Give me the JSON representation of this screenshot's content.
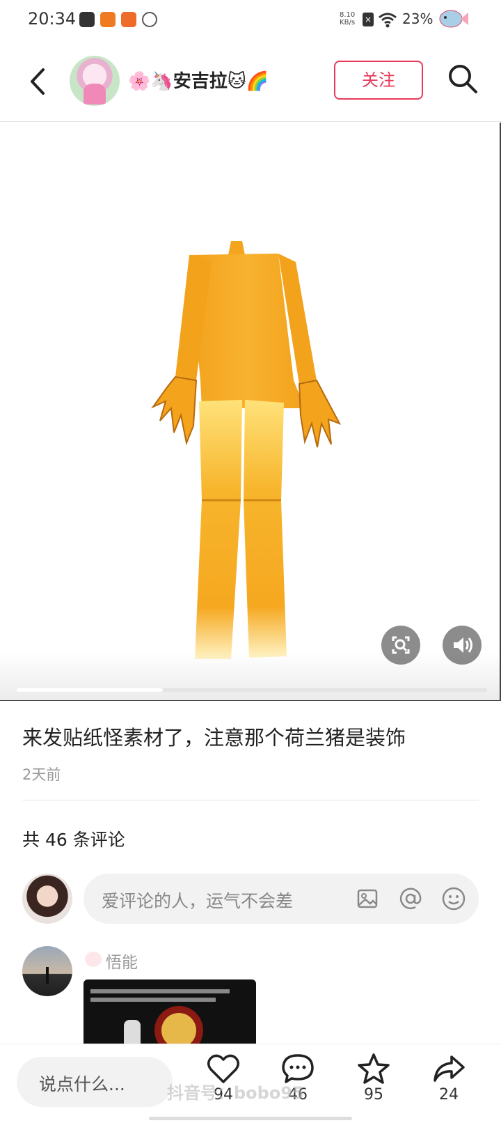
{
  "status_bar": {
    "time": "20:34",
    "net_speed_value": "8.10",
    "net_speed_unit": "KB/s",
    "battery": "23%",
    "icons": [
      "app-icon-dark",
      "app-icon-orange",
      "app-icon-orange-2",
      "app-icon-link",
      "sim-x-icon",
      "wifi-icon",
      "fish-icon"
    ]
  },
  "header": {
    "username": "🌸🦄安吉拉🐱🌈",
    "follow_label": "关注",
    "icons": [
      "back-icon",
      "search-icon"
    ]
  },
  "media": {
    "description_icons": [
      "scan-icon",
      "sound-icon"
    ],
    "progress_fraction": 0.31
  },
  "post": {
    "caption": "来发贴纸怪素材了，注意那个荷兰猪是装饰",
    "time_ago": "2天前",
    "comment_count_label": "共 46 条评论"
  },
  "comment_input": {
    "placeholder": "爱评论的人，运气不会差",
    "icons": [
      "image-icon",
      "at-icon",
      "emoji-icon"
    ]
  },
  "comments": [
    {
      "author": "悟能"
    }
  ],
  "bottom_bar": {
    "input_label": "说点什么...",
    "like_count": "94",
    "comment_count": "46",
    "favorite_count": "95",
    "share_count": "24",
    "watermark": "抖音号：bobo95"
  },
  "colors": {
    "accent": "#e83a5a",
    "figure_orange": "#f5a623"
  }
}
